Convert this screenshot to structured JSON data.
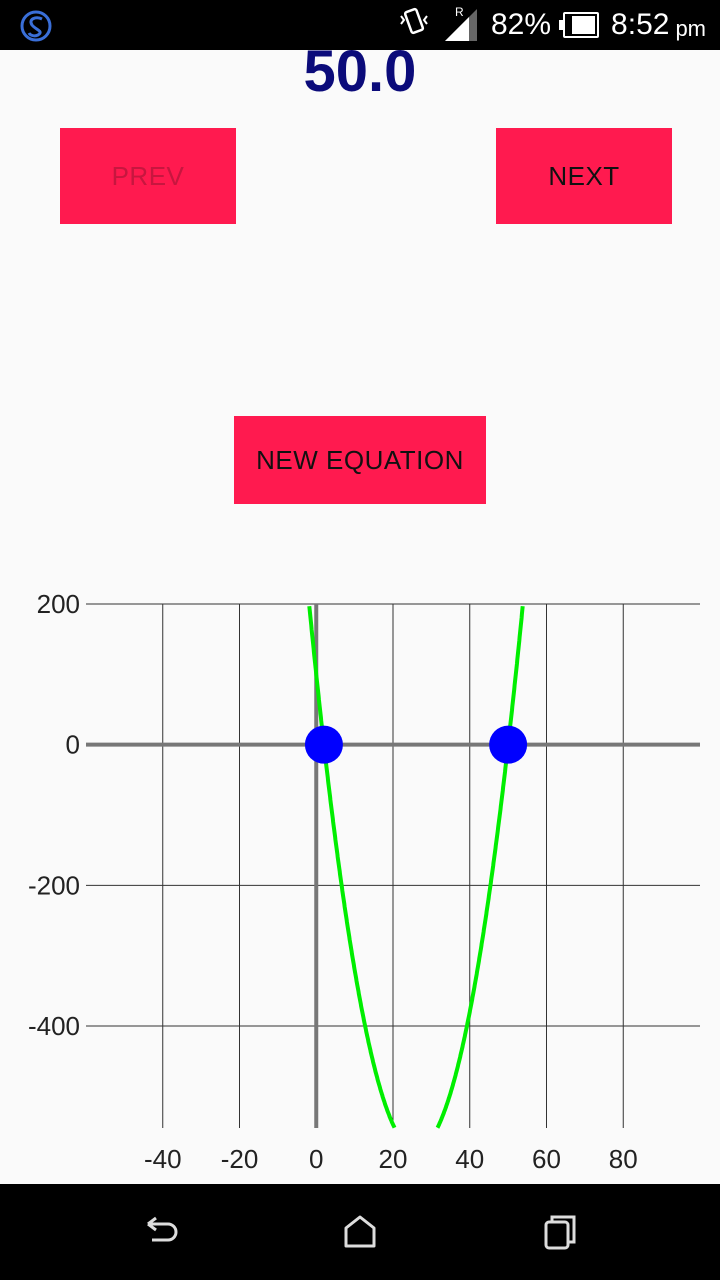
{
  "status_bar": {
    "app_icon": "s-logo-icon",
    "vibrate_icon": "vibrate-icon",
    "roaming_indicator": "R",
    "signal_icon": "signal-icon",
    "battery_percent": "82%",
    "battery_level": 0.82,
    "time": "8:52",
    "ampm": "pm"
  },
  "main": {
    "value": "50.0",
    "prev_label": "PREV",
    "next_label": "NEXT",
    "new_equation_label": "NEW EQUATION"
  },
  "chart_data": {
    "type": "line",
    "x_ticks": [
      -40,
      -20,
      0,
      20,
      40,
      60,
      80
    ],
    "y_ticks": [
      200,
      0,
      -200,
      -400
    ],
    "xlim": [
      -60,
      100
    ],
    "ylim": [
      -545,
      200
    ],
    "grid": true,
    "curve_color": "#00ee00",
    "root_color": "#0000ff",
    "series": [
      {
        "function": "x^2 - 52x + 100",
        "coefficients": [
          1,
          -52,
          100
        ]
      }
    ],
    "roots": [
      {
        "x": 2,
        "y": 0
      },
      {
        "x": 50,
        "y": 0
      }
    ]
  },
  "nav_bar": {
    "back_icon": "back-icon",
    "home_icon": "home-icon",
    "recents_icon": "recents-icon"
  }
}
